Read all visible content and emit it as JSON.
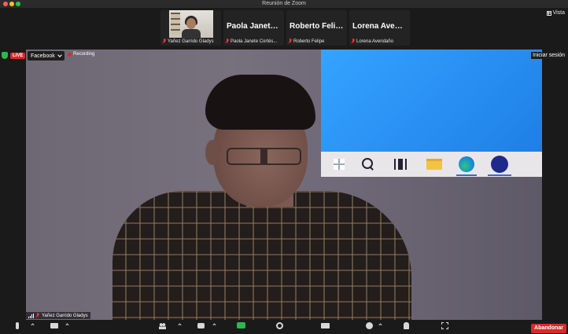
{
  "window": {
    "title": "Reunión de Zoom"
  },
  "header": {
    "view_label": "Vista"
  },
  "participants": [
    {
      "caption": "Yañez Garrido Gladys",
      "has_video": true,
      "display_name": ""
    },
    {
      "caption": "Paola Janete Cortés...",
      "has_video": false,
      "display_name": "Paola Janete..."
    },
    {
      "caption": "Roberto Felipe",
      "has_video": false,
      "display_name": "Roberto Felipe"
    },
    {
      "caption": "Lorena Avendaño",
      "has_video": false,
      "display_name": "Lorena Avend..."
    }
  ],
  "stream": {
    "live_badge": "LIVE",
    "platform": "Facebook",
    "recording_label": "Recording",
    "sign_in": "Iniciar sesión"
  },
  "speaker": {
    "name": "Yañez Garrido Gladys"
  },
  "toolbar": {
    "leave_label": "Abandonar"
  },
  "icons": {
    "taskbar": [
      "windows-start-icon",
      "search-icon",
      "task-view-icon",
      "file-explorer-icon",
      "edge-icon",
      "zoom-app-icon"
    ]
  },
  "colors": {
    "live_badge": "#e02828",
    "leave_button": "#d62b2b",
    "share_screen": "#2db84d",
    "desktop_blue": "#2a8ff0"
  }
}
